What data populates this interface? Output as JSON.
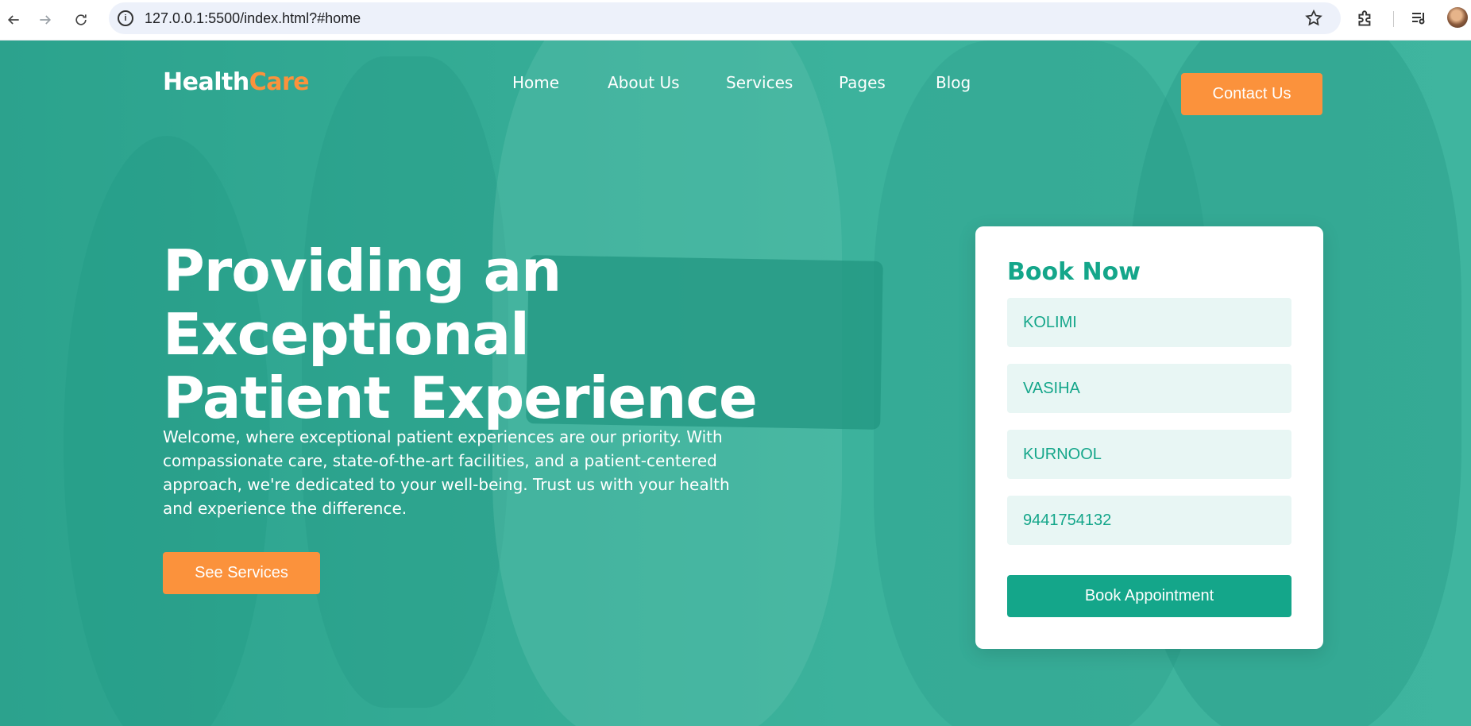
{
  "browser": {
    "url": "127.0.0.1:5500/index.html?#home"
  },
  "nav": {
    "logo_part1": "Health",
    "logo_part2": "Care",
    "items": [
      "Home",
      "About Us",
      "Services",
      "Pages",
      "Blog"
    ],
    "contact_label": "Contact Us"
  },
  "hero": {
    "headline_line1": "Providing an Exceptional",
    "headline_line2": "Patient Experience",
    "intro_lines": [
      "Welcome, where exceptional patient experiences are our priority. With",
      "compassionate care, state-of-the-art facilities, and a patient-centered",
      "approach, we're dedicated to your well-being. Trust us with your health",
      "and experience the difference."
    ],
    "see_services_label": "See Services"
  },
  "booking": {
    "title": "Book Now",
    "fields": [
      "KOLIMI",
      "VASIHA",
      "KURNOOL",
      "9441754132"
    ],
    "submit_label": "Book Appointment"
  },
  "colors": {
    "accent": "#fb923c",
    "brand": "#14a68a",
    "field_bg": "#e8f6f4"
  }
}
